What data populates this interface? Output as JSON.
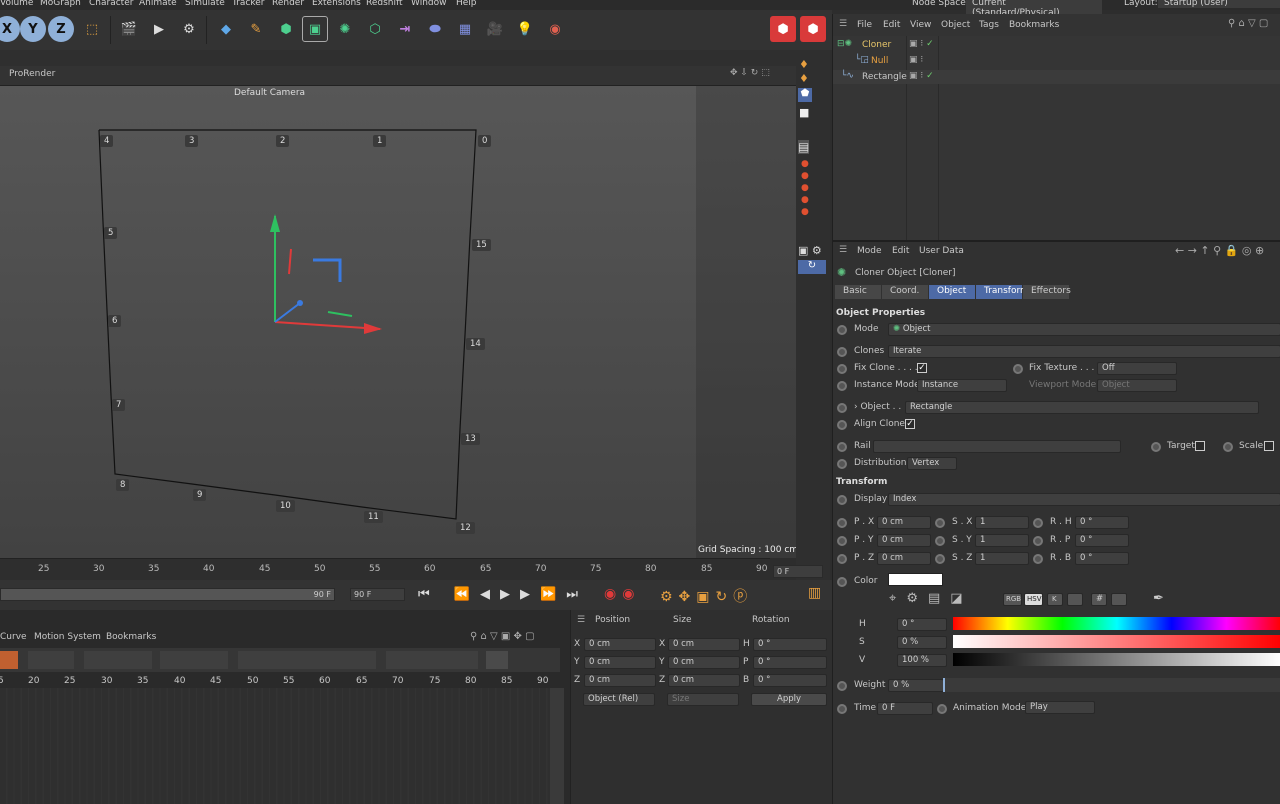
{
  "menu": [
    "Volume",
    "MoGraph",
    "Character",
    "Animate",
    "Simulate",
    "Tracker",
    "Render",
    "Extensions",
    "Redshift",
    "Window",
    "Help"
  ],
  "node_space": {
    "label": "Node Space:",
    "value": "Current (Standard/Physical)"
  },
  "layout": {
    "label": "Layout:",
    "value": "Startup (User)"
  },
  "toolbar": {
    "x": "X",
    "y": "Y",
    "z": "Z"
  },
  "viewport": {
    "renderer": "ProRender",
    "camera": "Default Camera",
    "grid_spacing": "Grid Spacing : 100 cm",
    "points": [
      "0",
      "1",
      "2",
      "3",
      "4",
      "5",
      "6",
      "7",
      "8",
      "9",
      "10",
      "11",
      "12",
      "13",
      "14",
      "15"
    ]
  },
  "timeline": {
    "ticks": [
      "25",
      "30",
      "35",
      "40",
      "45",
      "50",
      "55",
      "60",
      "65",
      "70",
      "75",
      "80",
      "85",
      "90"
    ],
    "end_field": "0 F",
    "range_end": "90 F",
    "current": "90 F"
  },
  "anim_panel": {
    "menu": [
      "Curve",
      "Motion System",
      "Bookmarks"
    ],
    "ticks": [
      "5",
      "20",
      "25",
      "30",
      "35",
      "40",
      "45",
      "50",
      "55",
      "60",
      "65",
      "70",
      "75",
      "80",
      "85",
      "90"
    ]
  },
  "coords": {
    "headers": [
      "Position",
      "Size",
      "Rotation"
    ],
    "rows": [
      {
        "a": "X",
        "pos": "0 cm",
        "b": "X",
        "size": "0 cm",
        "c": "H",
        "rot": "0 °"
      },
      {
        "a": "Y",
        "pos": "0 cm",
        "b": "Y",
        "size": "0 cm",
        "c": "P",
        "rot": "0 °"
      },
      {
        "a": "Z",
        "pos": "0 cm",
        "b": "Z",
        "size": "0 cm",
        "c": "B",
        "rot": "0 °"
      }
    ],
    "mode": "Object (Rel)",
    "size_mode": "Size",
    "apply": "Apply"
  },
  "object_manager": {
    "menu": [
      "File",
      "Edit",
      "View",
      "Object",
      "Tags",
      "Bookmarks"
    ],
    "items": [
      "Cloner",
      "Null",
      "Rectangle"
    ]
  },
  "attributes": {
    "menu": [
      "Mode",
      "Edit",
      "User Data"
    ],
    "title": "Cloner Object [Cloner]",
    "tabs": [
      "Basic",
      "Coord.",
      "Object",
      "Transform",
      "Effectors"
    ],
    "section_object": "Object Properties",
    "mode_label": "Mode",
    "mode_value": "Object",
    "clones_label": "Clones",
    "clones_value": "Iterate",
    "fix_clone": "Fix Clone . . . .",
    "fix_texture": "Fix Texture . . .",
    "fix_texture_value": "Off",
    "instance_mode": "Instance Mode",
    "instance_value": "Instance",
    "viewport_mode": "Viewport Mode",
    "viewport_value": "Object",
    "object_label": "Object . .",
    "object_value": "Rectangle",
    "align_clone": "Align Clone",
    "rail": "Rail",
    "target": "Target",
    "scale": "Scale",
    "distribution": "Distribution",
    "distribution_value": "Vertex",
    "section_transform": "Transform",
    "display": "Display",
    "display_value": "Index",
    "transform_rows": [
      {
        "l1": "P . X",
        "v1": "0 cm",
        "l2": "S . X",
        "v2": "1",
        "l3": "R . H",
        "v3": "0 °"
      },
      {
        "l1": "P . Y",
        "v1": "0 cm",
        "l2": "S . Y",
        "v2": "1",
        "l3": "R . P",
        "v3": "0 °"
      },
      {
        "l1": "P . Z",
        "v1": "0 cm",
        "l2": "S . Z",
        "v2": "1",
        "l3": "R . B",
        "v3": "0 °"
      }
    ],
    "color": "Color",
    "color_modes": [
      "RGB",
      "HSV",
      "K",
      "#"
    ],
    "h_label": "H",
    "h_value": "0 °",
    "s_label": "S",
    "s_value": "0 %",
    "v_label": "V",
    "v_value": "100 %",
    "weight": "Weight",
    "weight_value": "0 %",
    "time": "Time",
    "time_value": "0 F",
    "anim_mode": "Animation Mode",
    "anim_mode_value": "Play"
  },
  "colors": {
    "accent": "#4d6aa6",
    "cloner": "#e8c66a",
    "check": "#6fcf6f"
  }
}
